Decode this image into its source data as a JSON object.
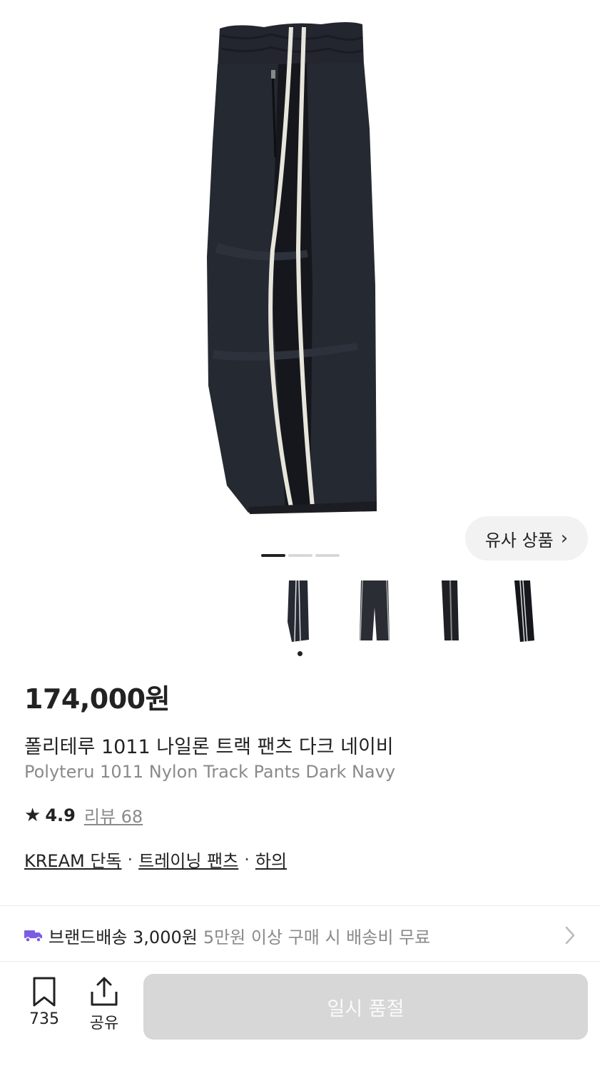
{
  "gallery": {
    "similar_label": "유사 상품",
    "page_count": 3,
    "current_page": 1,
    "thumbnail_count": 5,
    "selected_thumbnail": 1
  },
  "product": {
    "price": "174,000원",
    "name_ko": "폴리테루 1011 나일론 트랙 팬츠 다크 네이비",
    "name_en": "Polyteru 1011 Nylon Track Pants Dark Navy",
    "rating": "4.9",
    "reviews": "리뷰 68"
  },
  "tags": {
    "exclusive": "KREAM 단독",
    "category": "트레이닝 팬츠",
    "type": "하의",
    "separator": "·"
  },
  "shipping": {
    "label": "브랜드배송 3,000원",
    "note": "5만원 이상 구매 시 배송비 무료"
  },
  "bottom": {
    "bookmark_count": "735",
    "share_label": "공유",
    "action_label": "일시 품절"
  },
  "colors": {
    "shipping_icon": "#7b5ce4",
    "soldout_bg": "#d7d7d7",
    "text_primary": "#222222",
    "text_secondary": "#8a8a8a"
  }
}
